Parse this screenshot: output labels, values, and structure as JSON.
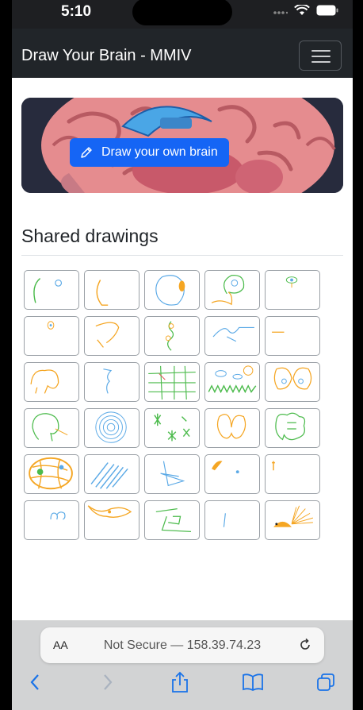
{
  "status_bar": {
    "time": "5:10"
  },
  "navbar": {
    "brand": "Draw Your Brain - MMIV",
    "menu_icon": "hamburger-icon"
  },
  "hero": {
    "button_label": "Draw your own brain",
    "button_icon": "pencil-icon"
  },
  "section": {
    "title": "Shared drawings"
  },
  "drawings": [
    {
      "id": 1
    },
    {
      "id": 2
    },
    {
      "id": 3
    },
    {
      "id": 4
    },
    {
      "id": 5
    },
    {
      "id": 6
    },
    {
      "id": 7
    },
    {
      "id": 8
    },
    {
      "id": 9
    },
    {
      "id": 10
    },
    {
      "id": 11
    },
    {
      "id": 12
    },
    {
      "id": 13
    },
    {
      "id": 14
    },
    {
      "id": 15
    },
    {
      "id": 16
    },
    {
      "id": 17
    },
    {
      "id": 18
    },
    {
      "id": 19
    },
    {
      "id": 20
    },
    {
      "id": 21
    },
    {
      "id": 22
    },
    {
      "id": 23
    },
    {
      "id": 24
    },
    {
      "id": 25
    },
    {
      "id": 26
    },
    {
      "id": 27
    },
    {
      "id": 28
    },
    {
      "id": 29
    },
    {
      "id": 30
    }
  ],
  "browser": {
    "text_size_label": "AA",
    "address": "Not Secure — 158.39.74.23",
    "toolbar_icons": [
      "back-icon",
      "forward-icon",
      "share-icon",
      "bookmarks-icon",
      "tabs-icon"
    ]
  },
  "colors": {
    "navbar": "#212529",
    "primary": "#1565f5",
    "drawing_green": "#4cbb4c",
    "drawing_orange": "#f5a623",
    "drawing_blue": "#5aa9e6"
  }
}
